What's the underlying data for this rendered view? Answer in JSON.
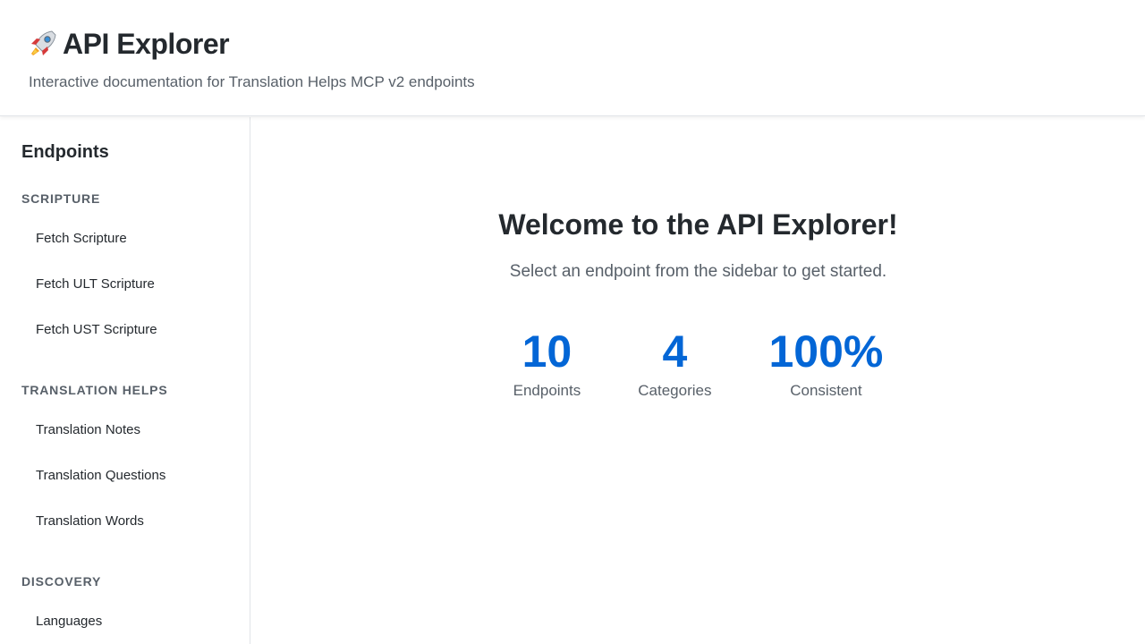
{
  "header": {
    "icon": "rocket-icon",
    "title": "API Explorer",
    "subtitle": "Interactive documentation for Translation Helps MCP v2 endpoints"
  },
  "sidebar": {
    "title": "Endpoints",
    "sections": [
      {
        "heading": "SCRIPTURE",
        "items": [
          "Fetch Scripture",
          "Fetch ULT Scripture",
          "Fetch UST Scripture"
        ]
      },
      {
        "heading": "TRANSLATION HELPS",
        "items": [
          "Translation Notes",
          "Translation Questions",
          "Translation Words"
        ]
      },
      {
        "heading": "DISCOVERY",
        "items": [
          "Languages"
        ]
      }
    ]
  },
  "main": {
    "welcome_title": "Welcome to the API Explorer!",
    "welcome_subtitle": "Select an endpoint from the sidebar to get started.",
    "stats": [
      {
        "value": "10",
        "label": "Endpoints"
      },
      {
        "value": "4",
        "label": "Categories"
      },
      {
        "value": "100%",
        "label": "Consistent"
      }
    ]
  },
  "colors": {
    "accent": "#0366d6",
    "text": "#24292e",
    "muted": "#586069",
    "border": "#e1e4e8"
  }
}
